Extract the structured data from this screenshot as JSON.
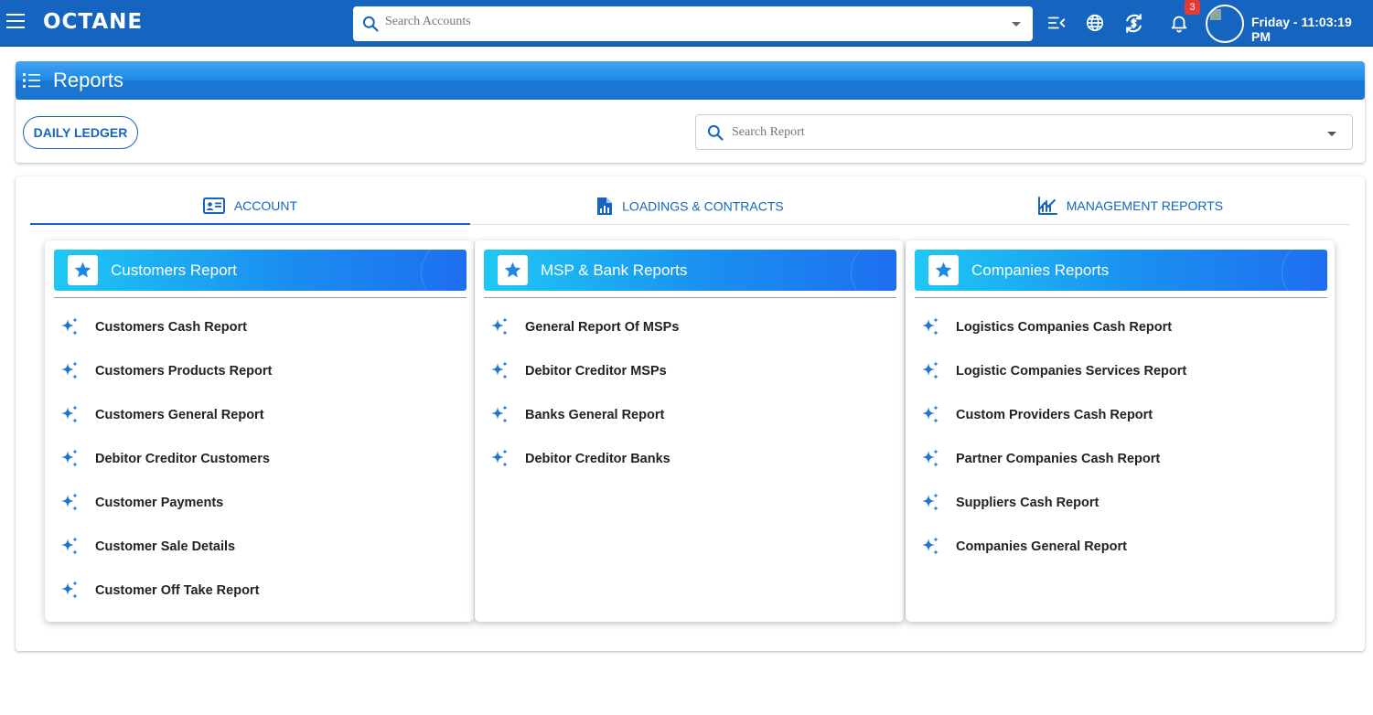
{
  "app": {
    "logo": "OCTANE",
    "account_search_placeholder": "Search Accounts",
    "notification_count": "3",
    "datetime": "Friday - 11:03:19 PM"
  },
  "page": {
    "title": "Reports",
    "daily_ledger_label": "DAILY LEDGER",
    "report_search_placeholder": "Search Report"
  },
  "tabs": [
    {
      "label": "ACCOUNT",
      "icon": "account-card-icon",
      "active": true
    },
    {
      "label": "LOADINGS & CONTRACTS",
      "icon": "report-chart-icon",
      "active": false
    },
    {
      "label": "MANAGEMENT REPORTS",
      "icon": "trending-chart-icon",
      "active": false
    }
  ],
  "columns": [
    {
      "title": "Customers Report",
      "items": [
        "Customers Cash Report",
        "Customers Products Report",
        "Customers General Report",
        "Debitor Creditor Customers",
        "Customer Payments",
        "Customer Sale Details",
        "Customer Off Take Report"
      ]
    },
    {
      "title": "MSP & Bank Reports",
      "items": [
        "General Report Of MSPs",
        "Debitor Creditor MSPs",
        "Banks General Report",
        "Debitor Creditor Banks"
      ]
    },
    {
      "title": "Companies Reports",
      "items": [
        "Logistics Companies Cash Report",
        "Logistic Companies Services Report",
        "Custom Providers Cash Report",
        "Partner Companies Cash Report",
        "Suppliers Cash Report",
        "Companies General Report"
      ]
    }
  ],
  "colors": {
    "primary": "#1565c0",
    "accent": "#1e88e5",
    "badge": "#e53935"
  }
}
